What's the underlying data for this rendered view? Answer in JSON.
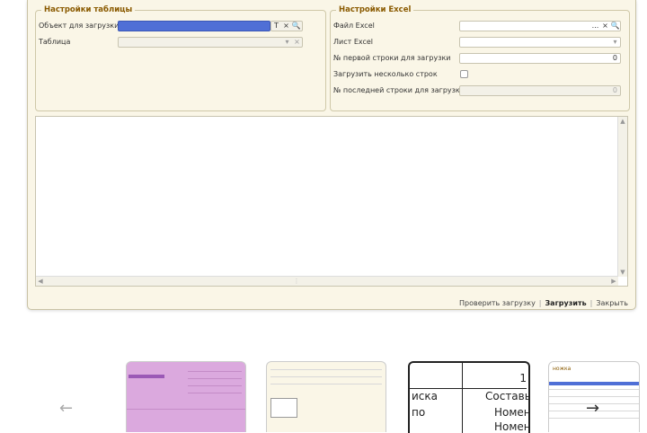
{
  "table_settings": {
    "legend": "Настройки таблицы",
    "object_label": "Объект для загрузки",
    "table_label": "Таблица",
    "object_buttons": [
      "T",
      "×",
      "🔍"
    ],
    "table_buttons": [
      "▾",
      "×"
    ]
  },
  "excel_settings": {
    "legend": "Настройки Excel",
    "file_label": "Файл Excel",
    "sheet_label": "Лист Excel",
    "first_row_label": "№ первой строки для загрузки",
    "first_row_value": "0",
    "multi_rows_label": "Загрузить несколько строк",
    "last_row_label": "№ последней строки для загрузки",
    "last_row_value": "0",
    "file_buttons": [
      "...",
      "×",
      "🔍"
    ]
  },
  "footer": {
    "check_label": "Проверить загрузку",
    "load_label": "Загрузить",
    "close_label": "Закрыть"
  },
  "carousel": {
    "prev_icon": "←",
    "next_icon": "→",
    "thumb3_lines": [
      "иска",
      "Составь",
      "по",
      "Номен",
      "Номен"
    ],
    "thumb3_number": "1",
    "thumb4_title": "ножка"
  },
  "colors": {
    "legend": "#8a5a00",
    "selection": "#4f6fd6",
    "panel_bg": "#faf6e7"
  }
}
